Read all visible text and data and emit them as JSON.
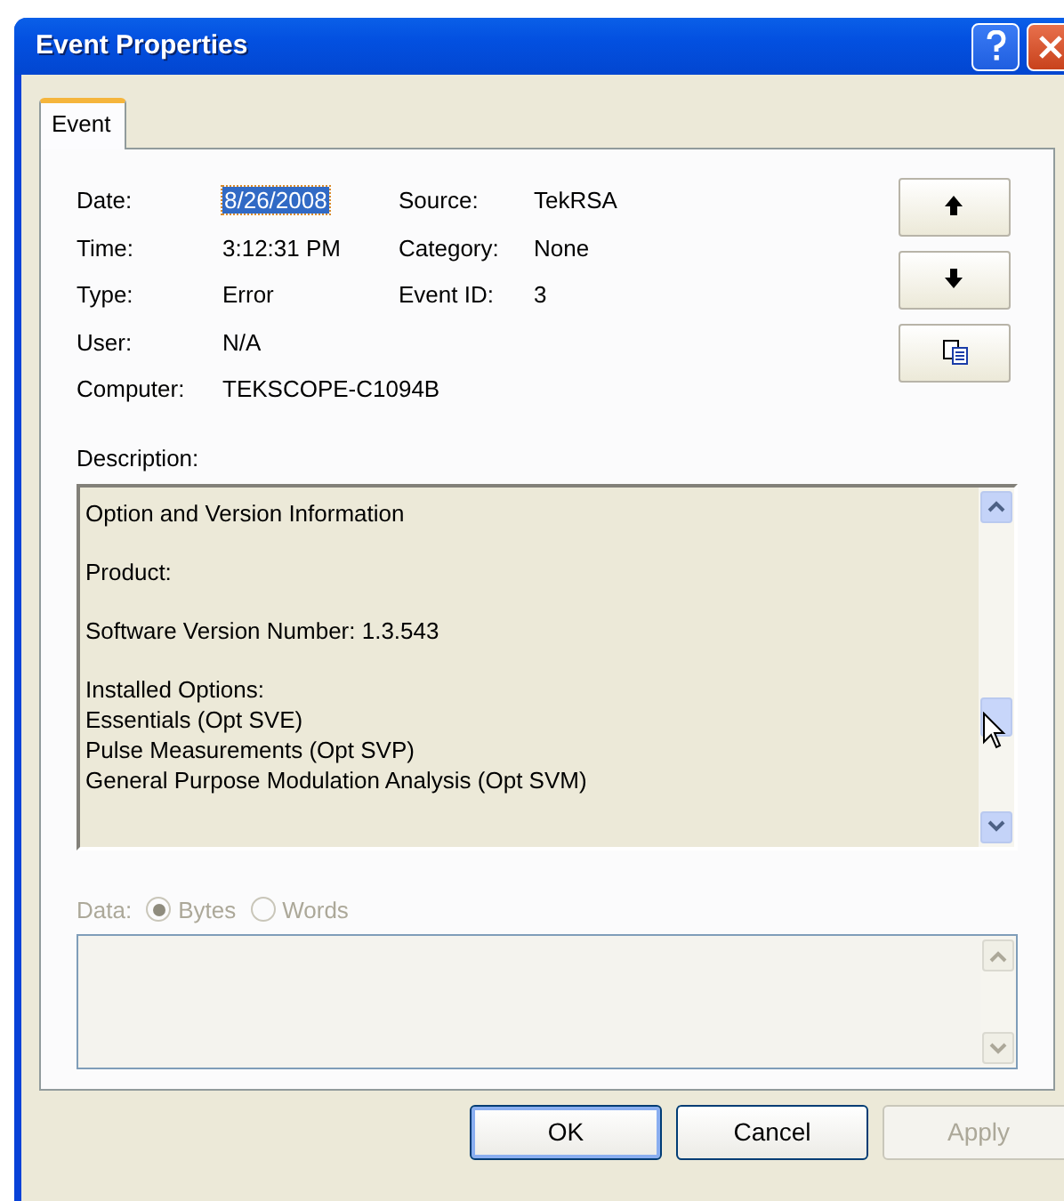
{
  "window": {
    "title": "Event Properties"
  },
  "tabs": [
    {
      "label": "Event",
      "selected": true
    }
  ],
  "left_fields": [
    {
      "label": "Date:",
      "value": "8/26/2008",
      "selected": true
    },
    {
      "label": "Time:",
      "value": "3:12:31 PM",
      "selected": false
    },
    {
      "label": "Type:",
      "value": "Error",
      "selected": false
    },
    {
      "label": "User:",
      "value": "N/A",
      "selected": false
    },
    {
      "label": "Computer:",
      "value": "TEKSCOPE-C1094B",
      "selected": false
    }
  ],
  "right_fields": [
    {
      "label": "Source:",
      "value": "TekRSA"
    },
    {
      "label": "Category:",
      "value": "None"
    },
    {
      "label": "Event ID:",
      "value": "3"
    }
  ],
  "side_buttons": [
    {
      "kind": "up"
    },
    {
      "kind": "down"
    },
    {
      "kind": "copy"
    }
  ],
  "description": {
    "label": "Description:",
    "paragraphs": [
      [
        "Option and Version Information"
      ],
      [
        "Product:"
      ],
      [
        "Software Version Number: 1.3.543"
      ],
      [
        "Installed Options:",
        "Essentials (Opt SVE)",
        "Pulse Measurements (Opt SVP)",
        "General Purpose Modulation Analysis (Opt SVM)"
      ]
    ]
  },
  "data": {
    "label": "Data:",
    "disabled": true,
    "options": [
      {
        "label": "Bytes",
        "selected": true
      },
      {
        "label": "Words",
        "selected": false
      }
    ]
  },
  "buttons": [
    {
      "label": "OK",
      "default": true,
      "disabled": false
    },
    {
      "label": "Cancel",
      "default": false,
      "disabled": false
    },
    {
      "label": "Apply",
      "default": false,
      "disabled": true
    }
  ]
}
